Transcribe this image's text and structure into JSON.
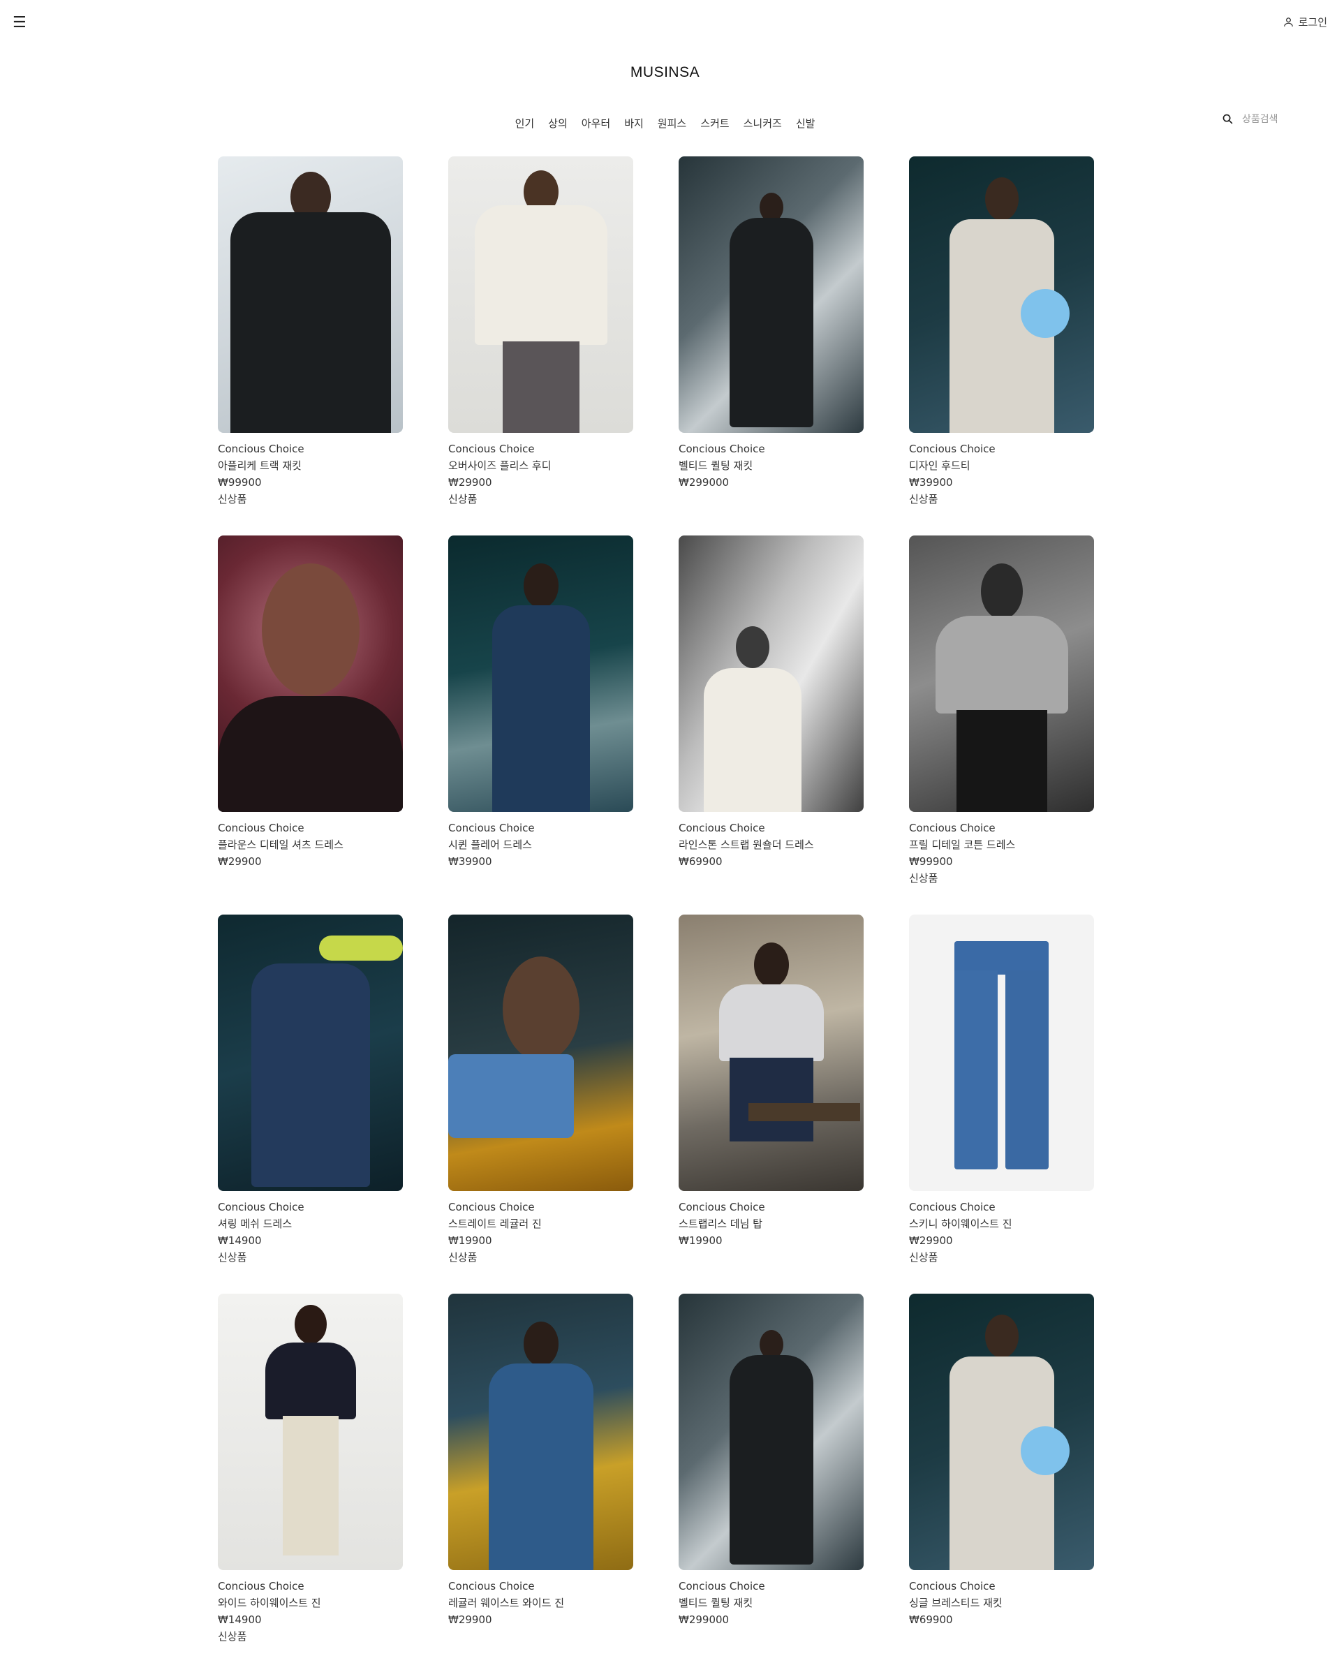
{
  "header": {
    "menu_icon": "☰",
    "login_label": "로그인",
    "logo": "MUSINSA",
    "categories": [
      "인기",
      "상의",
      "아우터",
      "바지",
      "원피스",
      "스커트",
      "스니커즈",
      "신발"
    ],
    "search_placeholder": "상품검색"
  },
  "products": [
    {
      "brand": "Concious Choice",
      "name": "아플리케 트랙 재킷",
      "price": "₩99900",
      "badge": "신상품",
      "image": "leather-jacket-photo"
    },
    {
      "brand": "Concious Choice",
      "name": "오버사이즈 플리스 후디",
      "price": "₩29900",
      "badge": "신상품",
      "image": "fleece-hoodie-photo"
    },
    {
      "brand": "Concious Choice",
      "name": "벨티드 퀼팅 재킷",
      "price": "₩299000",
      "badge": "",
      "image": "quilted-jacket-photo"
    },
    {
      "brand": "Concious Choice",
      "name": "디자인 후드티",
      "price": "₩39900",
      "badge": "신상품",
      "image": "design-hoodie-photo"
    },
    {
      "brand": "Concious Choice",
      "name": "플라운스 디테일 셔츠 드레스",
      "price": "₩29900",
      "badge": "",
      "image": "shirt-dress-photo"
    },
    {
      "brand": "Concious Choice",
      "name": "시퀸 플레어 드레스",
      "price": "₩39900",
      "badge": "",
      "image": "sequin-dress-photo"
    },
    {
      "brand": "Concious Choice",
      "name": "라인스톤 스트랩 원숄더 드레스",
      "price": "₩69900",
      "badge": "",
      "image": "one-shoulder-dress-photo"
    },
    {
      "brand": "Concious Choice",
      "name": "프릴 디테일 코튼 드레스",
      "price": "₩99900",
      "badge": "신상품",
      "image": "cotton-dress-photo"
    },
    {
      "brand": "Concious Choice",
      "name": "셔링 메쉬 드레스",
      "price": "₩14900",
      "badge": "신상품",
      "image": "mesh-dress-photo"
    },
    {
      "brand": "Concious Choice",
      "name": "스트레이트 레귤러 진",
      "price": "₩19900",
      "badge": "신상품",
      "image": "straight-jeans-photo"
    },
    {
      "brand": "Concious Choice",
      "name": "스트랩리스 데님 탑",
      "price": "₩19900",
      "badge": "",
      "image": "denim-top-photo"
    },
    {
      "brand": "Concious Choice",
      "name": "스키니 하이웨이스트 진",
      "price": "₩29900",
      "badge": "신상품",
      "image": "skinny-jeans-photo"
    },
    {
      "brand": "Concious Choice",
      "name": "와이드 하이웨이스트 진",
      "price": "₩14900",
      "badge": "신상품",
      "image": "wide-jeans-photo"
    },
    {
      "brand": "Concious Choice",
      "name": "레귤러 웨이스트 와이드 진",
      "price": "₩29900",
      "badge": "",
      "image": "regular-wide-jeans-photo"
    },
    {
      "brand": "Concious Choice",
      "name": "벨티드 퀼팅 재킷",
      "price": "₩299000",
      "badge": "",
      "image": "quilted-jacket-photo"
    },
    {
      "brand": "Concious Choice",
      "name": "싱글 브레스티드 재킷",
      "price": "₩69900",
      "badge": "",
      "image": "single-breasted-jacket-photo"
    }
  ]
}
